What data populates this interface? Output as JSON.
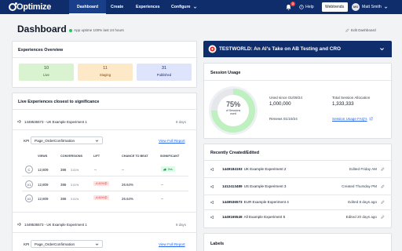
{
  "nav": {
    "logo": "Optimize",
    "items": [
      {
        "label": "Dashboard",
        "active": true
      },
      {
        "label": "Create"
      },
      {
        "label": "Experiences"
      },
      {
        "label": "Configure"
      }
    ],
    "notification_count": "3",
    "help": "Help",
    "account": "Webtrends",
    "user_initials": "MS",
    "user_name": "Matt Smith"
  },
  "header": {
    "title": "Dashboard",
    "uptime": "App uptime 100% last 24 hours",
    "edit": "Edit Dashboard"
  },
  "overview": {
    "title": "Experiences Overview",
    "stats": [
      {
        "value": "10",
        "label": "Live",
        "bg": "#d9f2cf",
        "color": "#1f5f1f"
      },
      {
        "value": "11",
        "label": "Staging",
        "bg": "#fde8c8",
        "color": "#7a4a10"
      },
      {
        "value": "31",
        "label": "Published",
        "bg": "#dde4fb",
        "color": "#1f2d6b"
      }
    ]
  },
  "live": {
    "title": "Live Experiences closest to significance",
    "experiments": [
      {
        "name": "1449536573 - UK Example Experiment 1",
        "age": "8 days",
        "kpi_label": "KPI",
        "kpi_value": "Page_OrderConfirmation",
        "report": "View Full Report",
        "headers": [
          "VIEWS",
          "CONVERSIONS",
          "LIFT",
          "CHANCE TO BEAT",
          "SIGNIFICANT"
        ],
        "rows": [
          {
            "variant": "C",
            "views": "12,809",
            "conv": "386",
            "rate": "3.01%",
            "lift": "--",
            "chance": "--",
            "sig": "Yes"
          },
          {
            "variant": "V1",
            "views": "12,809",
            "conv": "386",
            "rate": "3.01%",
            "lift": "-4.41%",
            "chance": "26.64%",
            "sig": "--"
          },
          {
            "variant": "V2",
            "views": "12,809",
            "conv": "386",
            "rate": "3.01%",
            "lift": "-4.41%",
            "chance": "26.64%",
            "sig": "--"
          }
        ]
      },
      {
        "name": "1449536573 - UK Example Experiment 1",
        "age": "8 days",
        "kpi_label": "KPI",
        "kpi_value": "Page_OrderConfirmation",
        "report": "View Full Report"
      }
    ]
  },
  "news": {
    "title": "TESTWORLD: An AI's Take on AB Testing and CRO"
  },
  "usage": {
    "title": "Session Usage",
    "percent": "75%",
    "percent_value": 75,
    "donut_label": "of Sessions used",
    "used_label": "Used since 01/09/24",
    "used_value": "1,000,000",
    "total_label": "Total Session Allocation",
    "total_value": "1,333,333",
    "renews": "Renews 01/10/24",
    "faqs": "Session Usage FAQ's"
  },
  "recent": {
    "title": "Recently Created/Edited",
    "items": [
      {
        "id": "1449184193",
        "name": "UK Example Experiment 2",
        "when": "Edited Friday AM"
      },
      {
        "id": "1412413489",
        "name": "US Example Experiment 3",
        "when": "Created Thursday PM"
      },
      {
        "id": "1449536573",
        "name": "EUR Example Experiment 4",
        "when": "Edited 8 days ago"
      },
      {
        "id": "1449165549",
        "name": "All Example Experiment 5",
        "when": "Edited 20 days ago"
      }
    ]
  },
  "labels": {
    "title": "Labels"
  }
}
